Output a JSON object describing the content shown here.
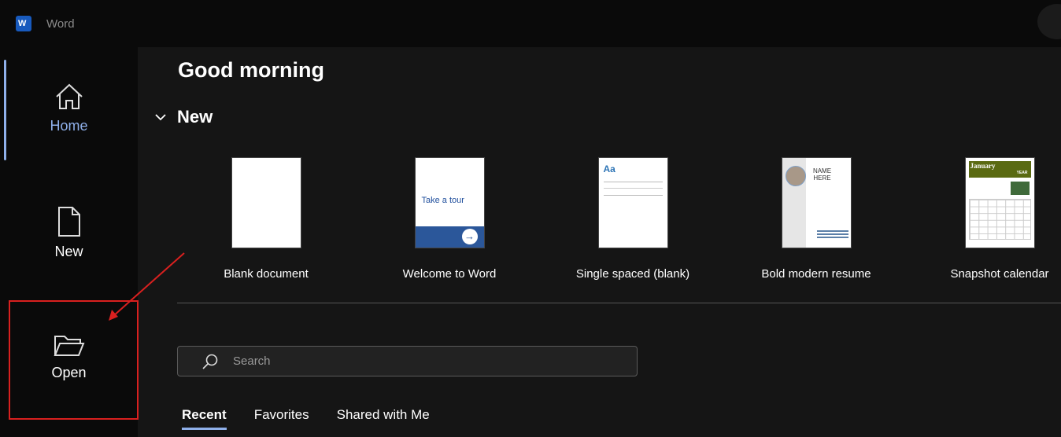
{
  "app": {
    "name": "Word",
    "logo_letter": "W"
  },
  "nav": {
    "items": [
      {
        "label": "Home",
        "icon": "home-icon",
        "active": true
      },
      {
        "label": "New",
        "icon": "new-document-icon"
      },
      {
        "label": "Open",
        "icon": "folder-open-icon"
      }
    ]
  },
  "main": {
    "greeting": "Good morning",
    "new_section": "New",
    "templates": [
      {
        "label": "Blank document"
      },
      {
        "label": "Welcome to Word",
        "thumb_text": "Take a tour"
      },
      {
        "label": "Single spaced (blank)",
        "thumb_text": "Aa"
      },
      {
        "label": "Bold modern resume",
        "thumb_text": "NAME HERE"
      },
      {
        "label": "Snapshot calendar",
        "thumb_text": "January",
        "thumb_sub": "YEAR"
      }
    ],
    "search": {
      "placeholder": "Search"
    },
    "tabs": [
      {
        "label": "Recent",
        "active": true
      },
      {
        "label": "Favorites"
      },
      {
        "label": "Shared with Me"
      }
    ]
  },
  "colors": {
    "accent": "#8fb0ea",
    "highlight": "#d9201f",
    "word_blue": "#185abd"
  }
}
